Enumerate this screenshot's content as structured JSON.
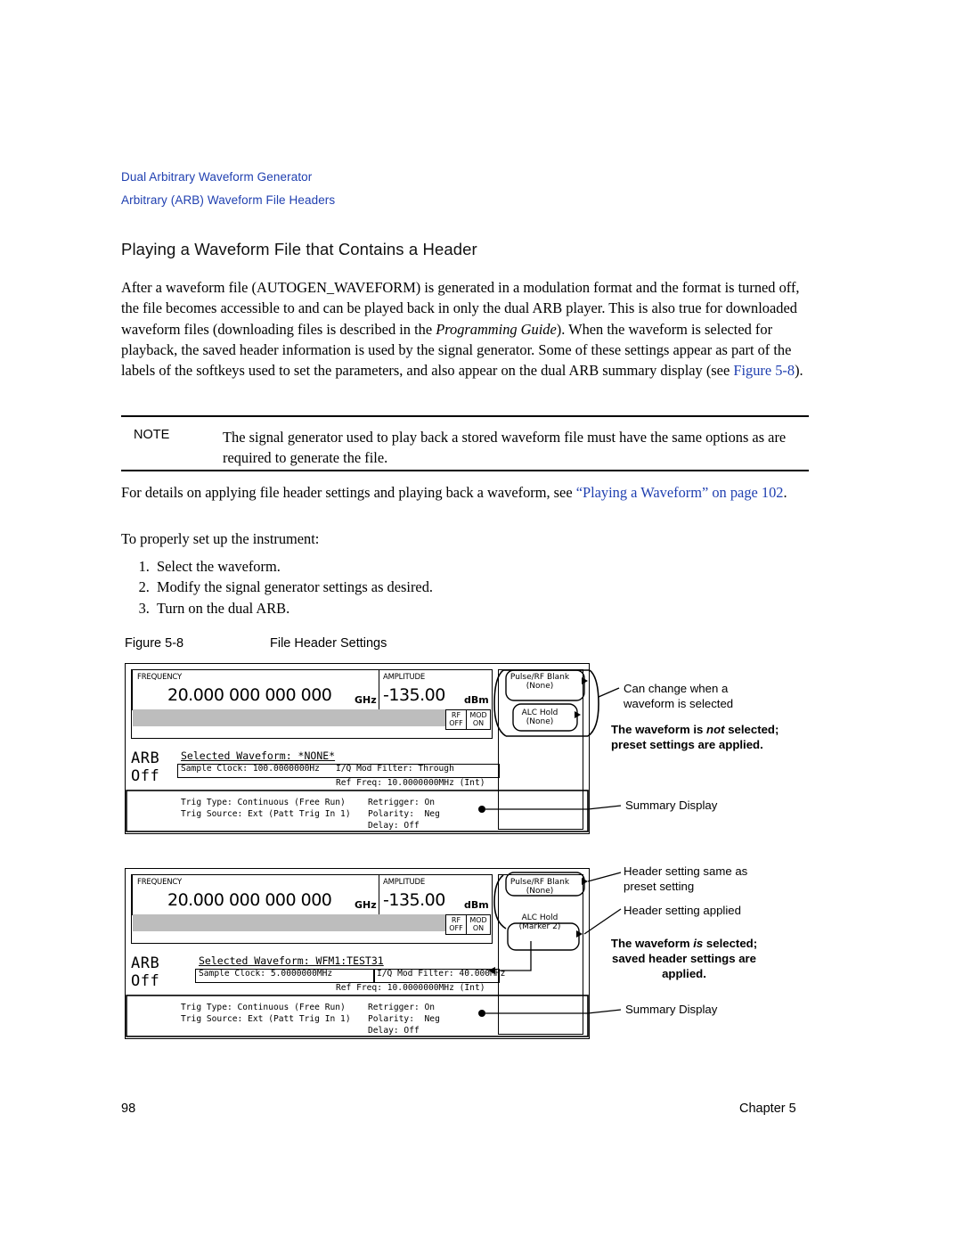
{
  "header": {
    "crumb1": "Dual Arbitrary Waveform Generator",
    "crumb2": "Arbitrary (ARB) Waveform File Headers"
  },
  "title": "Playing a Waveform File that Contains a Header",
  "paragraph1_html": "After a waveform file (AUTOGEN_WAVEFORM) is generated in a modulation format and the format is turned off, the file becomes accessible to and can be played back in only the dual ARB player. This is also true for downloaded waveform files (downloading files is described in the <i>Programming Guide</i>). When the waveform is selected for playback, the saved header information is used by the signal generator. Some of these settings appear as part of the labels of the softkeys used to set the parameters, and also appear on the dual ARB summary display (see <span class=\"link\">Figure 5-8</span>).",
  "note": {
    "label": "NOTE",
    "text": "The signal generator used to play back a stored waveform file must have the same options as are required to generate the file."
  },
  "paragraph2_html": "For details on applying file header settings and playing back a waveform, see <span class=\"link\">“Playing a Waveform” on page 102</span>.",
  "paragraph3": "To properly set up the instrument:",
  "steps": [
    "Select the waveform.",
    "Modify the signal generator settings as desired.",
    "Turn on the dual ARB."
  ],
  "figure": {
    "number": "Figure 5-8",
    "caption": "File Header Settings"
  },
  "panel1": {
    "frequency_label": "FREQUENCY",
    "frequency_value": "20.000 000 000 000",
    "frequency_unit": "GHz",
    "amplitude_label": "AMPLITUDE",
    "amplitude_value": "-135.00",
    "amplitude_unit": "dBm",
    "rf_label_top": "RF",
    "rf_label_bot": "OFF",
    "mod_label_top": "MOD",
    "mod_label_bot": "ON",
    "arb_word": "ARB",
    "arb_state": "Off",
    "selected_waveform": "Selected Waveform: *NONE*",
    "sample_clock": "Sample Clock: 100.0000000Hz",
    "io_mod_filter": "I/Q Mod Filter: Through",
    "ref_freq": "Ref Freq: 10.0000000MHz (Int)",
    "trig_type": "Trig Type: Continuous (Free Run)",
    "trig_source": "Trig Source: Ext (Patt Trig In 1)",
    "retrigger": "Retrigger: On",
    "polarity": "Polarity:  Neg",
    "delay": "Delay: Off",
    "softkey1_line1": "Pulse/RF Blank",
    "softkey1_line2": "(None)",
    "softkey2_line1": "ALC Hold",
    "softkey2_line2": "(None)"
  },
  "panel2": {
    "frequency_label": "FREQUENCY",
    "frequency_value": "20.000 000 000 000",
    "frequency_unit": "GHz",
    "amplitude_label": "AMPLITUDE",
    "amplitude_value": "-135.00",
    "amplitude_unit": "dBm",
    "rf_label_top": "RF",
    "rf_label_bot": "OFF",
    "mod_label_top": "MOD",
    "mod_label_bot": "ON",
    "arb_word": "ARB",
    "arb_state": "Off",
    "selected_waveform": "Selected Waveform: WFM1:TEST31",
    "sample_clock": "Sample Clock: 5.0000000MHz",
    "io_mod_filter": "I/Q Mod Filter: 40.000MHz",
    "ref_freq": "Ref Freq: 10.0000000MHz (Int)",
    "trig_type": "Trig Type: Continuous (Free Run)",
    "trig_source": "Trig Source: Ext (Patt Trig In 1)",
    "retrigger": "Retrigger: On",
    "polarity": "Polarity:  Neg",
    "delay": "Delay: Off",
    "softkey1_line1": "Pulse/RF Blank",
    "softkey1_line2": "(None)",
    "softkey2_line1": "ALC Hold",
    "softkey2_line2": "(Marker 2)"
  },
  "annotations": {
    "a1_line1": "Can change when a",
    "a1_line2": "waveform is selected",
    "a2_line1": "The waveform is",
    "a2_em": "not",
    "a2_line1b": "selected;",
    "a2_line2": "preset settings are applied.",
    "a3": "Summary Display",
    "b1_line1": "Header setting same as",
    "b1_line2": "preset setting",
    "b2": "Header setting applied",
    "b3_line1": "The waveform",
    "b3_em": "is",
    "b3_line1b": "selected;",
    "b3_line2": "saved header settings are",
    "b3_line3": "applied.",
    "b4": "Summary Display"
  },
  "footer": {
    "page_number": "98",
    "chapter": "Chapter 5"
  }
}
